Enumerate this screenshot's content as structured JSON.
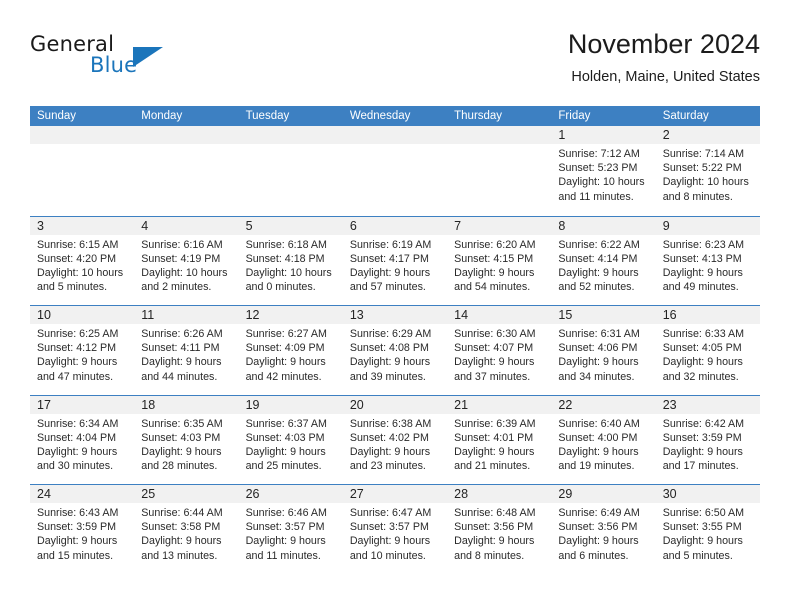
{
  "brand": {
    "name_part1": "General",
    "name_part2": "Blue",
    "logo_icon": "triangle-flag-icon"
  },
  "header": {
    "title": "November 2024",
    "location": "Holden, Maine, United States"
  },
  "colors": {
    "header_blue": "#3d80c2",
    "day_band_gray": "#f1f1f1",
    "brand_blue": "#1b75bb",
    "text": "#242424"
  },
  "weekdays": [
    "Sunday",
    "Monday",
    "Tuesday",
    "Wednesday",
    "Thursday",
    "Friday",
    "Saturday"
  ],
  "weeks": [
    [
      {
        "day": "",
        "lines": []
      },
      {
        "day": "",
        "lines": []
      },
      {
        "day": "",
        "lines": []
      },
      {
        "day": "",
        "lines": []
      },
      {
        "day": "",
        "lines": []
      },
      {
        "day": "1",
        "lines": [
          "Sunrise: 7:12 AM",
          "Sunset: 5:23 PM",
          "Daylight: 10 hours",
          "and 11 minutes."
        ]
      },
      {
        "day": "2",
        "lines": [
          "Sunrise: 7:14 AM",
          "Sunset: 5:22 PM",
          "Daylight: 10 hours",
          "and 8 minutes."
        ]
      }
    ],
    [
      {
        "day": "3",
        "lines": [
          "Sunrise: 6:15 AM",
          "Sunset: 4:20 PM",
          "Daylight: 10 hours",
          "and 5 minutes."
        ]
      },
      {
        "day": "4",
        "lines": [
          "Sunrise: 6:16 AM",
          "Sunset: 4:19 PM",
          "Daylight: 10 hours",
          "and 2 minutes."
        ]
      },
      {
        "day": "5",
        "lines": [
          "Sunrise: 6:18 AM",
          "Sunset: 4:18 PM",
          "Daylight: 10 hours",
          "and 0 minutes."
        ]
      },
      {
        "day": "6",
        "lines": [
          "Sunrise: 6:19 AM",
          "Sunset: 4:17 PM",
          "Daylight: 9 hours",
          "and 57 minutes."
        ]
      },
      {
        "day": "7",
        "lines": [
          "Sunrise: 6:20 AM",
          "Sunset: 4:15 PM",
          "Daylight: 9 hours",
          "and 54 minutes."
        ]
      },
      {
        "day": "8",
        "lines": [
          "Sunrise: 6:22 AM",
          "Sunset: 4:14 PM",
          "Daylight: 9 hours",
          "and 52 minutes."
        ]
      },
      {
        "day": "9",
        "lines": [
          "Sunrise: 6:23 AM",
          "Sunset: 4:13 PM",
          "Daylight: 9 hours",
          "and 49 minutes."
        ]
      }
    ],
    [
      {
        "day": "10",
        "lines": [
          "Sunrise: 6:25 AM",
          "Sunset: 4:12 PM",
          "Daylight: 9 hours",
          "and 47 minutes."
        ]
      },
      {
        "day": "11",
        "lines": [
          "Sunrise: 6:26 AM",
          "Sunset: 4:11 PM",
          "Daylight: 9 hours",
          "and 44 minutes."
        ]
      },
      {
        "day": "12",
        "lines": [
          "Sunrise: 6:27 AM",
          "Sunset: 4:09 PM",
          "Daylight: 9 hours",
          "and 42 minutes."
        ]
      },
      {
        "day": "13",
        "lines": [
          "Sunrise: 6:29 AM",
          "Sunset: 4:08 PM",
          "Daylight: 9 hours",
          "and 39 minutes."
        ]
      },
      {
        "day": "14",
        "lines": [
          "Sunrise: 6:30 AM",
          "Sunset: 4:07 PM",
          "Daylight: 9 hours",
          "and 37 minutes."
        ]
      },
      {
        "day": "15",
        "lines": [
          "Sunrise: 6:31 AM",
          "Sunset: 4:06 PM",
          "Daylight: 9 hours",
          "and 34 minutes."
        ]
      },
      {
        "day": "16",
        "lines": [
          "Sunrise: 6:33 AM",
          "Sunset: 4:05 PM",
          "Daylight: 9 hours",
          "and 32 minutes."
        ]
      }
    ],
    [
      {
        "day": "17",
        "lines": [
          "Sunrise: 6:34 AM",
          "Sunset: 4:04 PM",
          "Daylight: 9 hours",
          "and 30 minutes."
        ]
      },
      {
        "day": "18",
        "lines": [
          "Sunrise: 6:35 AM",
          "Sunset: 4:03 PM",
          "Daylight: 9 hours",
          "and 28 minutes."
        ]
      },
      {
        "day": "19",
        "lines": [
          "Sunrise: 6:37 AM",
          "Sunset: 4:03 PM",
          "Daylight: 9 hours",
          "and 25 minutes."
        ]
      },
      {
        "day": "20",
        "lines": [
          "Sunrise: 6:38 AM",
          "Sunset: 4:02 PM",
          "Daylight: 9 hours",
          "and 23 minutes."
        ]
      },
      {
        "day": "21",
        "lines": [
          "Sunrise: 6:39 AM",
          "Sunset: 4:01 PM",
          "Daylight: 9 hours",
          "and 21 minutes."
        ]
      },
      {
        "day": "22",
        "lines": [
          "Sunrise: 6:40 AM",
          "Sunset: 4:00 PM",
          "Daylight: 9 hours",
          "and 19 minutes."
        ]
      },
      {
        "day": "23",
        "lines": [
          "Sunrise: 6:42 AM",
          "Sunset: 3:59 PM",
          "Daylight: 9 hours",
          "and 17 minutes."
        ]
      }
    ],
    [
      {
        "day": "24",
        "lines": [
          "Sunrise: 6:43 AM",
          "Sunset: 3:59 PM",
          "Daylight: 9 hours",
          "and 15 minutes."
        ]
      },
      {
        "day": "25",
        "lines": [
          "Sunrise: 6:44 AM",
          "Sunset: 3:58 PM",
          "Daylight: 9 hours",
          "and 13 minutes."
        ]
      },
      {
        "day": "26",
        "lines": [
          "Sunrise: 6:46 AM",
          "Sunset: 3:57 PM",
          "Daylight: 9 hours",
          "and 11 minutes."
        ]
      },
      {
        "day": "27",
        "lines": [
          "Sunrise: 6:47 AM",
          "Sunset: 3:57 PM",
          "Daylight: 9 hours",
          "and 10 minutes."
        ]
      },
      {
        "day": "28",
        "lines": [
          "Sunrise: 6:48 AM",
          "Sunset: 3:56 PM",
          "Daylight: 9 hours",
          "and 8 minutes."
        ]
      },
      {
        "day": "29",
        "lines": [
          "Sunrise: 6:49 AM",
          "Sunset: 3:56 PM",
          "Daylight: 9 hours",
          "and 6 minutes."
        ]
      },
      {
        "day": "30",
        "lines": [
          "Sunrise: 6:50 AM",
          "Sunset: 3:55 PM",
          "Daylight: 9 hours",
          "and 5 minutes."
        ]
      }
    ]
  ]
}
